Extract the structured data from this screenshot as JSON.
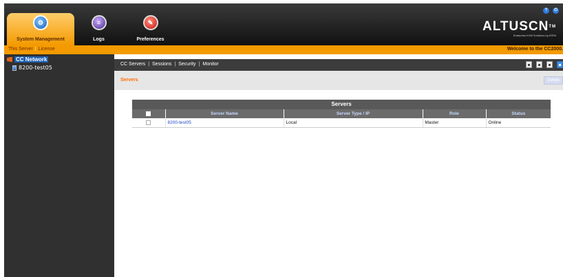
{
  "nav": {
    "system_management": "System Management",
    "logs": "Logs",
    "preferences": "Preferences"
  },
  "top_icons": [
    "help-icon",
    "logout-icon"
  ],
  "brand": {
    "logo": "ALTUSCN",
    "trademark": "TM",
    "tagline": "Enterprise KVM Solutions by ATEN"
  },
  "subbar": {
    "links": [
      "This Server",
      "License"
    ],
    "welcome": "Welcome to the CC2000."
  },
  "tree": {
    "root": "CC Network",
    "child": "8200-test05"
  },
  "tabs": [
    "CC Servers",
    "Sessions",
    "Security",
    "Monitor"
  ],
  "toolbar_icons": [
    "tool-icon-1",
    "tool-icon-2",
    "tool-icon-3",
    "tool-icon-4"
  ],
  "crumb": "Servers",
  "delete_label": "Delete",
  "table": {
    "title": "Servers",
    "columns": [
      "Server Name",
      "Server Type / IP",
      "Role",
      "Status"
    ],
    "rows": [
      {
        "name": "8200-test05",
        "type": "Local",
        "role": "Master",
        "status": "Online"
      }
    ]
  },
  "colors": {
    "accent_orange": "#f39a00",
    "tree_bg": "#303030",
    "link_blue": "#2046c8"
  }
}
